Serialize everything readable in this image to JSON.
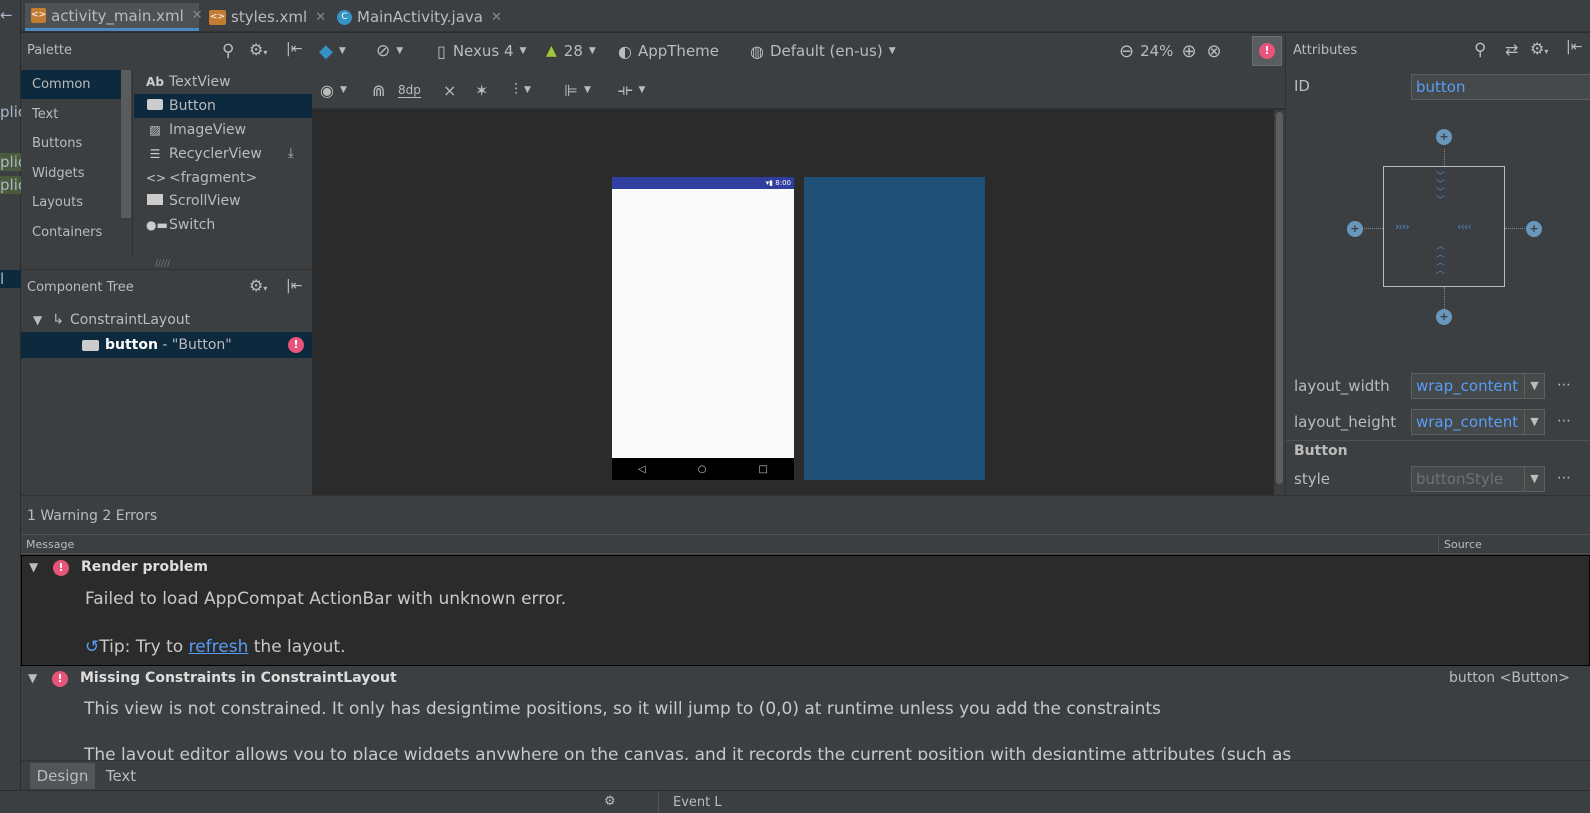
{
  "left_strip": {
    "fragments": [
      "←",
      "plic",
      "plic",
      "plic",
      "l"
    ]
  },
  "tabs": [
    {
      "label": "activity_main.xml",
      "icon": "xml-file-icon",
      "active": true
    },
    {
      "label": "styles.xml",
      "icon": "xml-file-icon",
      "active": false
    },
    {
      "label": "MainActivity.java",
      "icon": "java-class-icon",
      "active": false
    }
  ],
  "palette": {
    "title": "Palette",
    "categories": [
      "Common",
      "Text",
      "Buttons",
      "Widgets",
      "Layouts",
      "Containers"
    ],
    "items": [
      {
        "label": "TextView",
        "icon": "textview-icon"
      },
      {
        "label": "Button",
        "icon": "button-icon"
      },
      {
        "label": "ImageView",
        "icon": "imageview-icon"
      },
      {
        "label": "RecyclerView",
        "icon": "recyclerview-icon"
      },
      {
        "label": "<fragment>",
        "icon": "fragment-icon"
      },
      {
        "label": "ScrollView",
        "icon": "scrollview-icon"
      },
      {
        "label": "Switch",
        "icon": "switch-icon"
      }
    ]
  },
  "component_tree": {
    "title": "Component Tree",
    "root": "ConstraintLayout",
    "child_id": "button",
    "child_text": " - \"Button\""
  },
  "design_toolbar": {
    "device": "Nexus 4",
    "api": "28",
    "theme": "AppTheme",
    "locale": "Default (en-us)",
    "zoom": "24%",
    "margin": "8dp"
  },
  "device_preview": {
    "status_time": "8:00"
  },
  "attributes": {
    "title": "Attributes",
    "id_label": "ID",
    "id_value": "button",
    "layout_width_label": "layout_width",
    "layout_width_value": "wrap_content",
    "layout_height_label": "layout_height",
    "layout_height_value": "wrap_content",
    "section": "Button",
    "style_label": "style",
    "style_value": "buttonStyle",
    "more": "⋯"
  },
  "messages": {
    "summary": "1 Warning 2 Errors",
    "col_message": "Message",
    "col_source": "Source",
    "items": [
      {
        "title": "Render problem",
        "text": "Failed to load AppCompat ActionBar with unknown error.",
        "tip_prefix": "Tip: Try to ",
        "tip_link": "refresh",
        "tip_suffix": " the layout."
      },
      {
        "title": "Missing Constraints in ConstraintLayout",
        "source": "button <Button>",
        "text": "This view is not constrained. It only has designtime positions, so it will jump to (0,0) at runtime unless you add the constraints",
        "text2": "The layout editor allows you to place widgets anywhere on the canvas, and it records the current position with designtime attributes (such as"
      }
    ]
  },
  "bottom_tabs": [
    "Design",
    "Text"
  ],
  "status_bar": {
    "text": "Event L"
  },
  "colors": {
    "accent": "#4a88c7",
    "error": "#e8547a",
    "link": "#589df6",
    "selection": "#0d293e"
  }
}
